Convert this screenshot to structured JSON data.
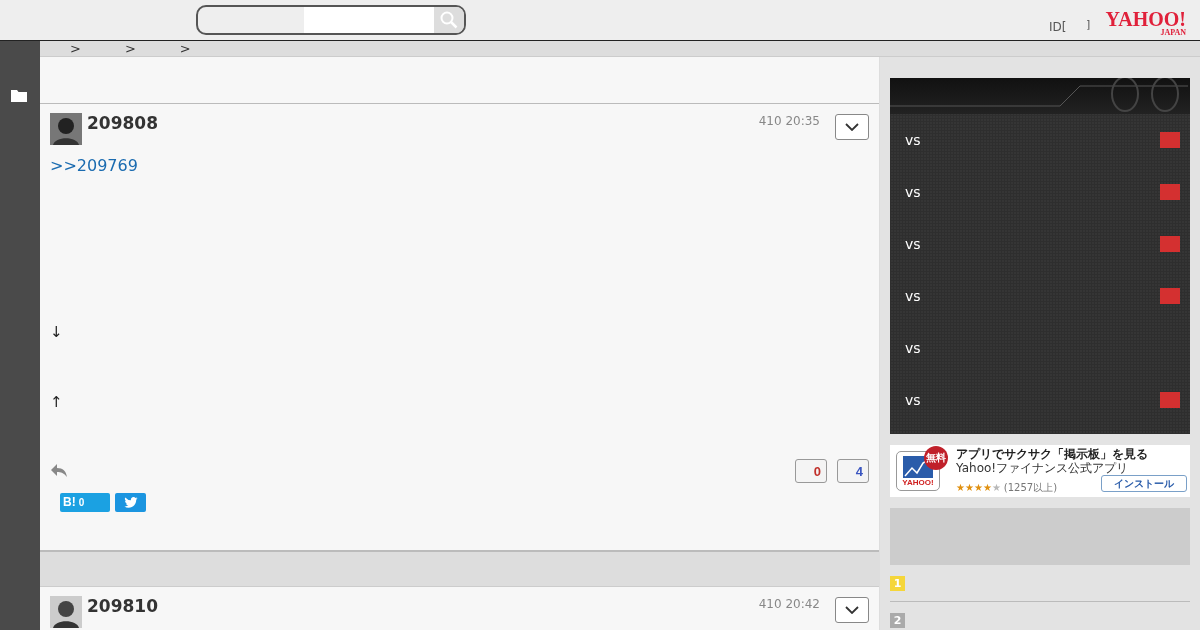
{
  "header": {
    "id_text": "ID[",
    "bracket": "]",
    "logo": "YAHOO!",
    "logo_sub": "JAPAN"
  },
  "breadcrumb": [
    ">",
    ">",
    ">"
  ],
  "posts": [
    {
      "number": "209808",
      "time": "410 20:35",
      "reply_link": ">>209769",
      "lines": [
        "↓",
        "↑"
      ],
      "likes": "0",
      "dislikes": "4",
      "hatena": "B!",
      "hatena_count": "0"
    },
    {
      "number": "209810",
      "time": "410 20:42"
    }
  ],
  "games": [
    {
      "vs": "vs",
      "live": true
    },
    {
      "vs": "vs",
      "live": true
    },
    {
      "vs": "vs",
      "live": true
    },
    {
      "vs": "vs",
      "live": true
    },
    {
      "vs": "vs",
      "live": false
    },
    {
      "vs": "vs",
      "live": true
    }
  ],
  "ad": {
    "badge": "無料",
    "icon_text": "YAHOO!",
    "title": "アプリでサクサク「掲示板」を見る",
    "subtitle": "Yahoo!ファイナンス公式アプリ",
    "stars": 4,
    "rating": "(1257以上)",
    "button": "インストール"
  },
  "ranking": [
    {
      "rank": "1",
      "color": "#f5d63a"
    },
    {
      "rank": "2",
      "color": "#aaaaaa"
    }
  ]
}
